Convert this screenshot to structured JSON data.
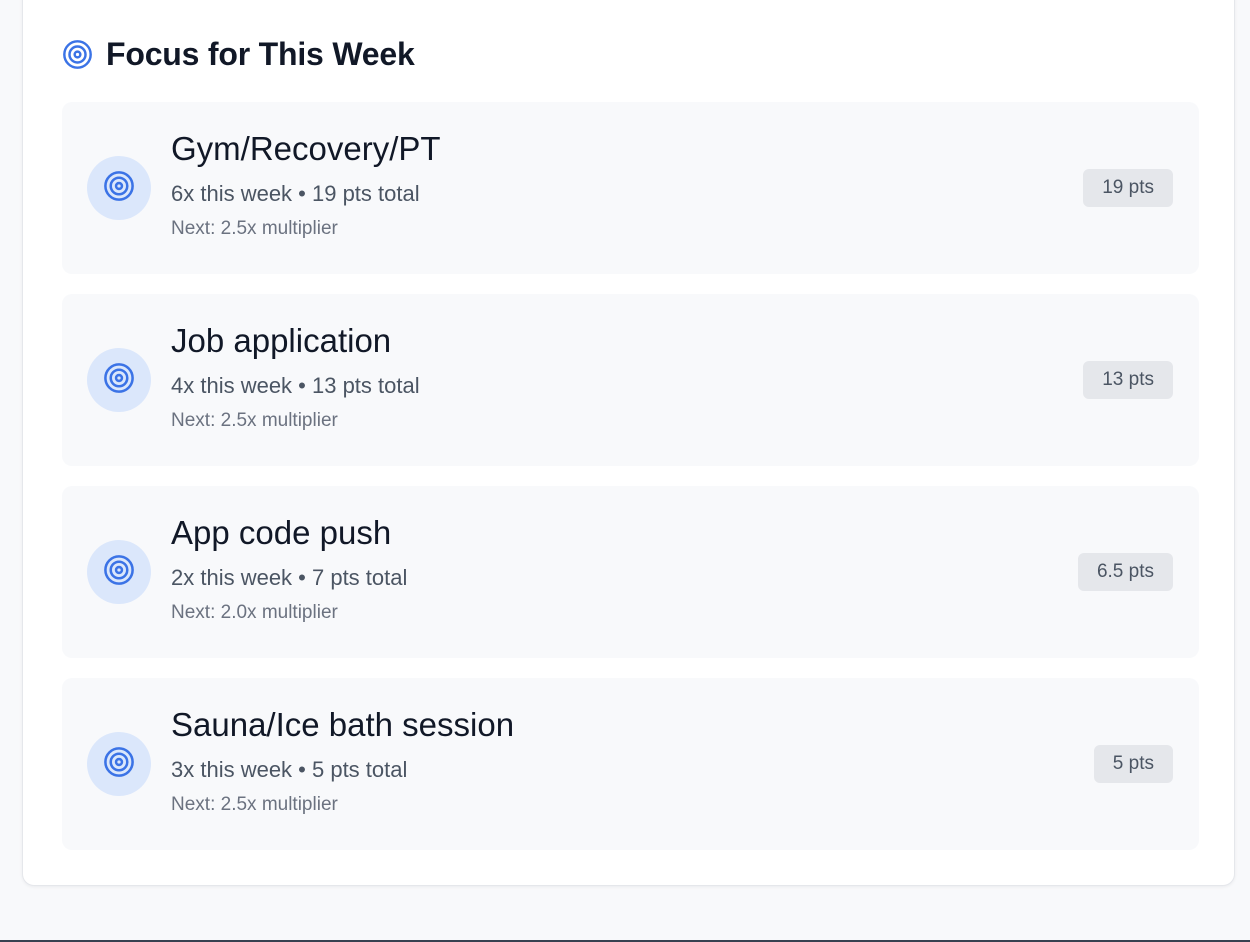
{
  "colors": {
    "accent": "#3b73e6",
    "icon_circle_bg": "#dbe7fb",
    "item_bg": "#f8f9fb",
    "badge_bg": "#e5e7eb"
  },
  "section": {
    "title": "Focus for This Week",
    "icon": "target-icon"
  },
  "items": [
    {
      "icon": "target-icon",
      "title": "Gym/Recovery/PT",
      "stats": "6x this week • 19 pts total",
      "next": "Next: 2.5x multiplier",
      "points": "19 pts"
    },
    {
      "icon": "target-icon",
      "title": "Job application",
      "stats": "4x this week • 13 pts total",
      "next": "Next: 2.5x multiplier",
      "points": "13 pts"
    },
    {
      "icon": "target-icon",
      "title": "App code push",
      "stats": "2x this week • 7 pts total",
      "next": "Next: 2.0x multiplier",
      "points": "6.5 pts"
    },
    {
      "icon": "target-icon",
      "title": "Sauna/Ice bath session",
      "stats": "3x this week • 5 pts total",
      "next": "Next: 2.5x multiplier",
      "points": "5 pts"
    }
  ]
}
